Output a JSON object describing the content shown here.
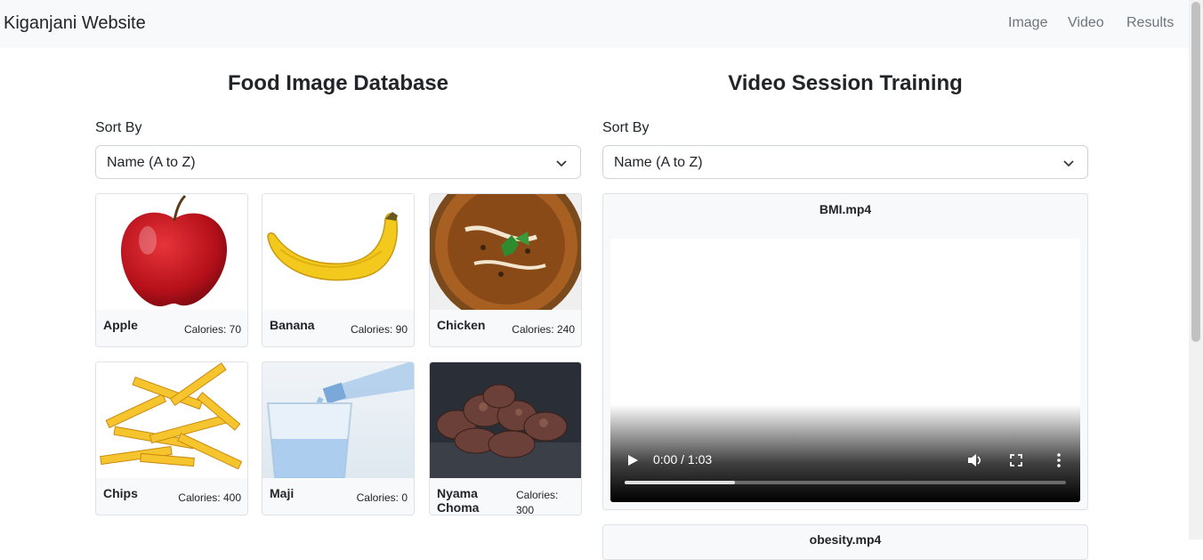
{
  "navbar": {
    "brand": "Kiganjani Website",
    "links": [
      "Image",
      "Video",
      "Results"
    ]
  },
  "food_section": {
    "title": "Food Image Database",
    "sort_label": "Sort By",
    "sort_value": "Name (A to Z)",
    "items": [
      {
        "name": "Apple",
        "calories": "Calories: 70",
        "icon": "apple-image"
      },
      {
        "name": "Banana",
        "calories": "Calories: 90",
        "icon": "banana-image"
      },
      {
        "name": "Chicken",
        "calories": "Calories: 240",
        "icon": "chicken-curry-image"
      },
      {
        "name": "Chips",
        "calories": "Calories: 400",
        "icon": "fries-image"
      },
      {
        "name": "Maji",
        "calories": "Calories: 0",
        "icon": "water-glass-image"
      },
      {
        "name": "Nyama Choma",
        "calories": "Calories: 300",
        "icon": "grilled-meat-image"
      }
    ]
  },
  "video_section": {
    "title": "Video Session Training",
    "sort_label": "Sort By",
    "sort_value": "Name (A to Z)",
    "videos": [
      {
        "title": "BMI.mp4",
        "time": "0:00 / 1:03",
        "progress": 0.25
      },
      {
        "title": "obesity.mp4"
      }
    ]
  },
  "colors": {
    "navbar_bg": "#f8f9fa",
    "muted_link": "#6c757d",
    "border": "#dee2e6"
  }
}
